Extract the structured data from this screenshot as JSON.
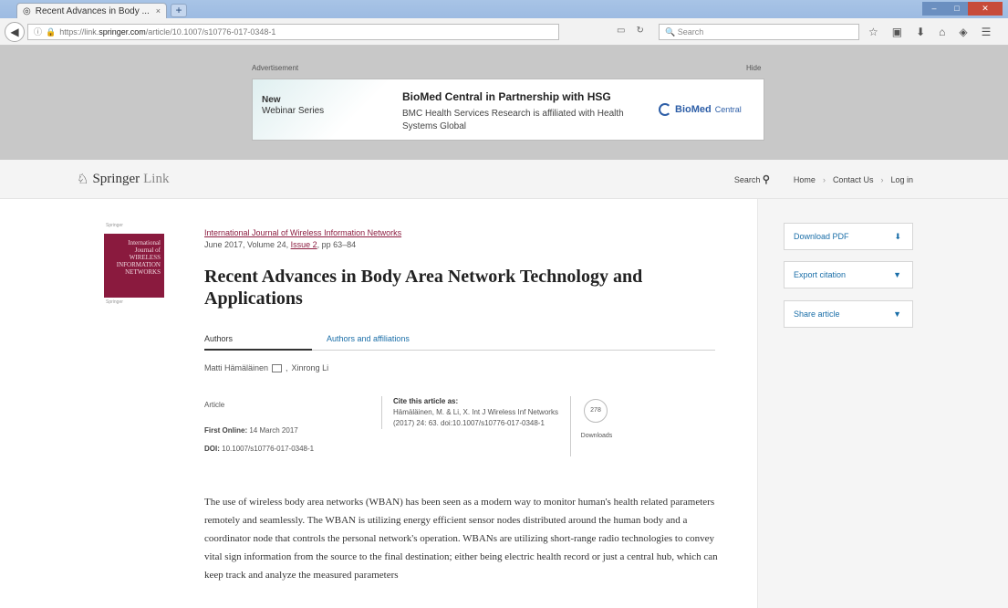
{
  "browser": {
    "tab_title": "Recent Advances in Body ...",
    "tab_close": "×",
    "new_tab": "+",
    "url_scheme": "https://link.",
    "url_host": "springer.com",
    "url_path": "/article/10.1007/s10776-017-0348-1",
    "search_placeholder": "Search"
  },
  "ad": {
    "label": "Advertisement",
    "hide": "Hide",
    "new": "New",
    "webinar": "Webinar Series",
    "title": "BioMed Central in Partnership with HSG",
    "text": "BMC Health Services Research is affiliated with Health Systems Global",
    "logo_bold": "BioMed",
    "logo_rest": "Central"
  },
  "header": {
    "logo_main": "Springer",
    "logo_sub": "Link",
    "search": "Search",
    "home": "Home",
    "contact": "Contact Us",
    "login": "Log in",
    "sep": "›"
  },
  "sidebar": {
    "download": "Download PDF",
    "export": "Export citation",
    "share": "Share article"
  },
  "cover": {
    "top": "Springer",
    "body_line1": "International",
    "body_line2": "Journal of",
    "body_line3": "WIRELESS",
    "body_line4": "INFORMATION",
    "body_line5": "NETWORKS",
    "bottom": "Springer"
  },
  "article": {
    "journal": "International Journal of Wireless Information Networks",
    "date": "June 2017, Volume 24,",
    "issue": "Issue 2",
    "pages": ", pp 63–84",
    "title": "Recent Advances in Body Area Network Technology and Applications",
    "tab_authors": "Authors",
    "tab_affil": "Authors and affiliations",
    "author1": "Matti Hämäläinen",
    "author_sep": ",",
    "author2": "Xinrong Li",
    "type": "Article",
    "first_online_label": "First Online:",
    "first_online": "14 March 2017",
    "doi_label": "DOI:",
    "doi": "10.1007/s10776-017-0348-1",
    "cite_head": "Cite this article as:",
    "cite_body": "Hämäläinen, M. & Li, X. Int J Wireless Inf Networks (2017) 24: 63. doi:10.1007/s10776-017-0348-1",
    "downloads": "278",
    "downloads_label": "Downloads",
    "abstract": "The use of wireless body area networks (WBAN) has been seen as a modern way to monitor human's health related parameters remotely and seamlessly. The WBAN is utilizing energy efficient sensor nodes distributed around the human body and a coordinator node that controls the personal network's operation. WBANs are utilizing short-range radio technologies to convey vital sign information from the source to the final destination; either being electric health record or just a central hub, which can keep track and analyze the measured parameters"
  }
}
